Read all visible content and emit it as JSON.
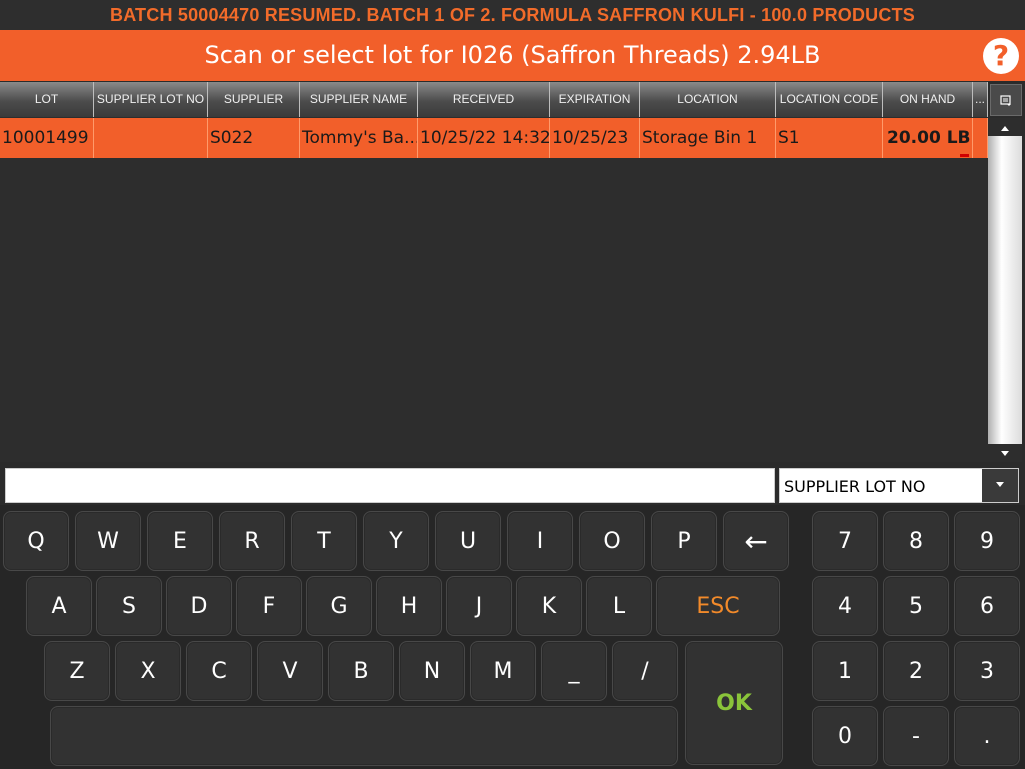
{
  "status": "BATCH 50004470 RESUMED. BATCH 1 OF 2. FORMULA SAFFRON KULFI - 100.0 PRODUCTS",
  "prompt": "Scan or select lot for I026 (Saffron Threads) 2.94LB",
  "help": "?",
  "grid": {
    "columns": [
      "LOT",
      "SUPPLIER LOT NO",
      "SUPPLIER",
      "SUPPLIER NAME",
      "RECEIVED",
      "EXPIRATION",
      "LOCATION",
      "LOCATION CODE",
      "ON HAND",
      "..."
    ],
    "rows": [
      {
        "lot": "10001499",
        "supplier_lot_no": "",
        "supplier": "S022",
        "supplier_name": "Tommy's Ba...",
        "received": "10/25/22 14:32",
        "expiration": "10/25/23",
        "location": "Storage Bin 1",
        "location_code": "S1",
        "on_hand": "20.00 LB"
      }
    ]
  },
  "search": {
    "value": "",
    "field": "SUPPLIER LOT NO"
  },
  "keyboard": {
    "row1": [
      "Q",
      "W",
      "E",
      "R",
      "T",
      "Y",
      "U",
      "I",
      "O",
      "P"
    ],
    "backspace": "←",
    "row2": [
      "A",
      "S",
      "D",
      "F",
      "G",
      "H",
      "J",
      "K",
      "L"
    ],
    "esc": "ESC",
    "row3": [
      "Z",
      "X",
      "C",
      "V",
      "B",
      "N",
      "M",
      "_",
      "/"
    ],
    "ok": "OK",
    "numpad": [
      "7",
      "8",
      "9",
      "4",
      "5",
      "6",
      "1",
      "2",
      "3",
      "0",
      "-",
      "."
    ]
  },
  "colors": {
    "accent": "#f25f2a",
    "ok": "#8ac43a",
    "esc": "#f28a2a"
  }
}
